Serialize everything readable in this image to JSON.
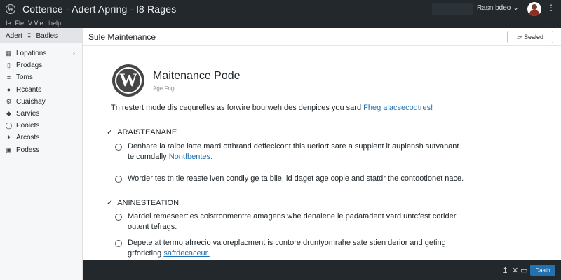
{
  "titlebar": {
    "title": "Cotterice - Adert Apring - l8 Rages",
    "user_name": "Rasn bdeo"
  },
  "menubar": {
    "items": [
      "Ie",
      "Fle",
      "V Vle",
      "Ihelp"
    ]
  },
  "sidebar": {
    "header_label": "Adert",
    "header_label_2": "Badles",
    "items": [
      {
        "label": "Lopations",
        "icon": "grid-icon",
        "has_chevron": true
      },
      {
        "label": "Prodags",
        "icon": "page-icon"
      },
      {
        "label": "Toms",
        "icon": "list-icon"
      },
      {
        "label": "Rccants",
        "icon": "user-icon"
      },
      {
        "label": "Cuaishay",
        "icon": "gear-icon"
      },
      {
        "label": "Sarvies",
        "icon": "tag-icon"
      },
      {
        "label": "Poolets",
        "icon": "circle-icon"
      },
      {
        "label": "Arcosts",
        "icon": "star-icon"
      },
      {
        "label": "Podess",
        "icon": "box-icon"
      }
    ]
  },
  "main": {
    "page_title": "Sule Maintenance",
    "header_button": "Sealed",
    "plugin": {
      "name": "Maitenance Pode",
      "subtitle": "Age Fngt"
    },
    "description": "Tn restert mode dis cequrelles as forwire bourweh des denpices you sard",
    "description_link": "Fheg alacsecodtres!",
    "sections": [
      {
        "title": "ARAISTEANANE",
        "options": [
          {
            "text": "Denhare ia raibe latte mard otthrand deffeclcont this uerlort sare a supplent it auplensh sutvanant te cumdally",
            "link": "Nontfbentes."
          },
          {
            "text": "Worder tes tn tie reaste iven condly ge ta bile, id daget age cople and statdr the contootionet nace.",
            "link": ""
          }
        ]
      },
      {
        "title": "ANINESTEATION",
        "options": [
          {
            "text": "Mardel remeseertles colstronmentre amagens whe denalene le padatadent vard untcfest corider outent tefrags.",
            "link": ""
          },
          {
            "text": "Depete at termo afrrecio valoreplacment is contore druntyomrahe sate stien derior and geting grforicting",
            "link": "saftdecaceur."
          }
        ]
      }
    ]
  },
  "bottombar": {
    "button_label": "Daath"
  }
}
